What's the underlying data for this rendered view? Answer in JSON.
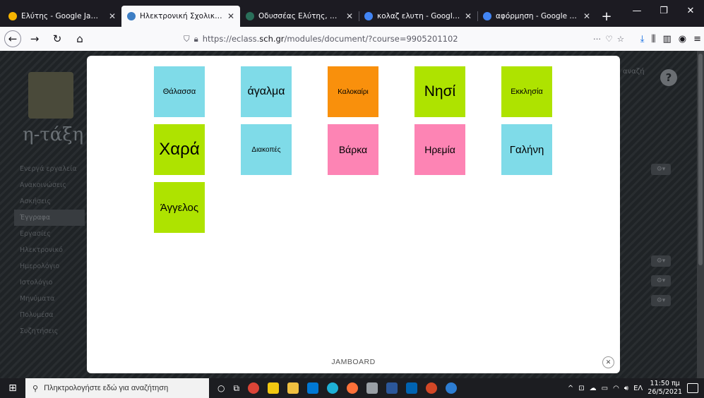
{
  "browser": {
    "tabs": [
      {
        "title": "Ελύτης - Google Jamboard",
        "close": "✕",
        "color": "#f6b400"
      },
      {
        "title": "Ηλεκτρονική Σχολική Τάξη | Ε",
        "close": "✕",
        "color": "#3d7ec4"
      },
      {
        "title": "Οδυσσέας Ελύτης, Ο ήλιος ο",
        "close": "✕",
        "color": "#2a6f5a"
      },
      {
        "title": "κολαζ ελυτη - Google Search",
        "close": "✕",
        "color": "#4285f4"
      },
      {
        "title": "αφόρμηση - Google Search",
        "close": "✕",
        "color": "#4285f4"
      }
    ],
    "new_tab": "+",
    "url_prefix": "https://eclass.",
    "url_domain": "sch.gr",
    "url_rest": "/modules/document/?course=9905201102"
  },
  "background": {
    "logo_text": "η-τάξη",
    "side_items": [
      "Ενεργά εργαλεία",
      "Ανακοινώσεις",
      "Ασκήσεις",
      "Έγγραφα",
      "Εργασίες",
      "Ηλεκτρονικό",
      "Ημερολόγιο",
      "Ιστολόγιο",
      "Μηνύματα",
      "Πολυμέσα",
      "Συζητήσεις"
    ],
    "right_label": "αναζή"
  },
  "jamboard": {
    "footer": "JAMBOARD",
    "close_icon": "✕",
    "notes": [
      {
        "text": "Θάλασσα",
        "color": "#7fdbe8",
        "size": 11
      },
      {
        "text": "άγαλμα",
        "color": "#7fdbe8",
        "size": 16
      },
      {
        "text": "Καλοκαίρι",
        "color": "#f9900c",
        "size": 10
      },
      {
        "text": "Νησί",
        "color": "#aee300",
        "size": 21
      },
      {
        "text": "Εκκλησία",
        "color": "#aee300",
        "size": 11
      },
      {
        "text": "Χαρά",
        "color": "#aee300",
        "size": 24
      },
      {
        "text": "Διακοπές",
        "color": "#7fdbe8",
        "size": 10
      },
      {
        "text": "Βάρκα",
        "color": "#fd84b4",
        "size": 14
      },
      {
        "text": "Ηρεμία",
        "color": "#fd84b4",
        "size": 14
      },
      {
        "text": "Γαλήνη",
        "color": "#7fdbe8",
        "size": 15
      },
      {
        "text": "Άγγελος",
        "color": "#aee300",
        "size": 15
      }
    ]
  },
  "taskbar": {
    "search_placeholder": "Πληκτρολογήστε εδώ για αναζήτηση",
    "language": "ΕΛ",
    "time": "11:50 πμ",
    "date": "26/5/2021"
  }
}
